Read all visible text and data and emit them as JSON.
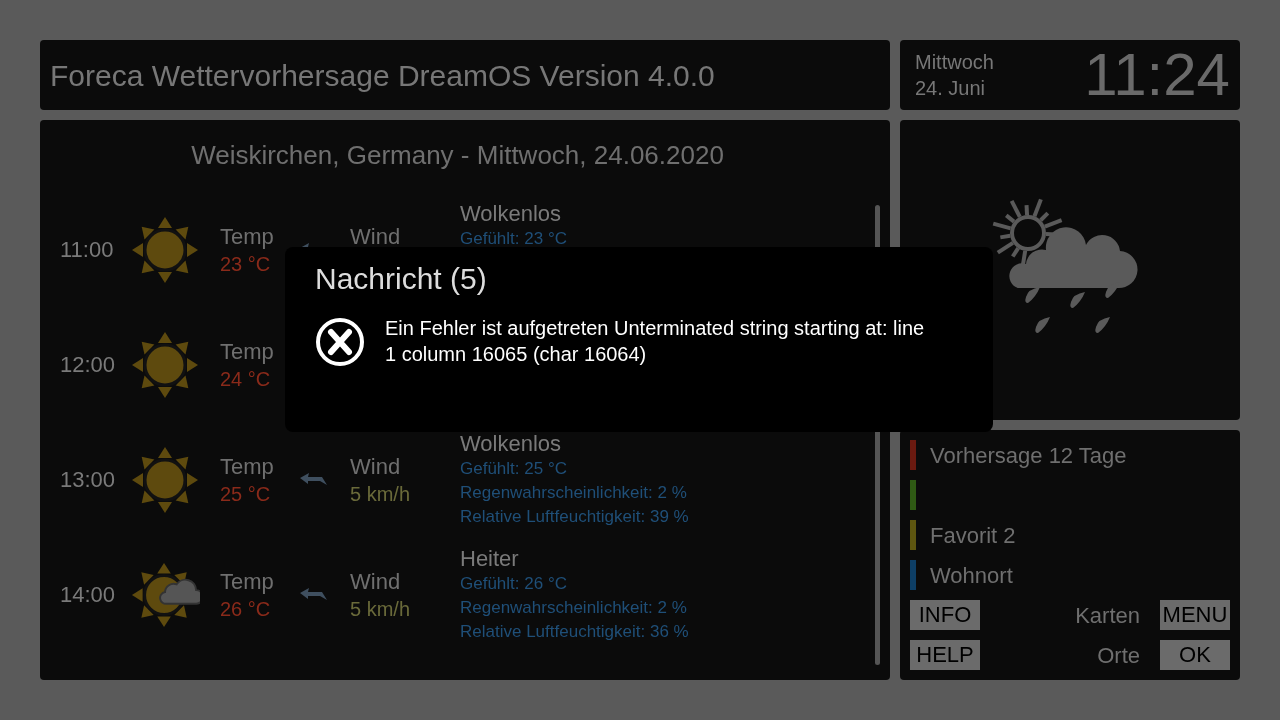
{
  "header": {
    "title": "Foreca Wettervorhersage DreamOS Version 4.0.0"
  },
  "clock": {
    "weekday": "Mittwoch",
    "date": "24. Juni",
    "time": "11:24"
  },
  "forecast": {
    "heading": "Weiskirchen, Germany - Mittwoch, 24.06.2020",
    "rows": [
      {
        "time": "11:00",
        "kind": "sun",
        "temp_label": "Temp",
        "temp": "23 °C",
        "wind_label": "Wind",
        "condition": "Wolkenlos",
        "feels": "Gefühlt: 23 °C"
      },
      {
        "time": "12:00",
        "kind": "sun",
        "temp_label": "Temp",
        "temp": "24 °C"
      },
      {
        "time": "13:00",
        "kind": "sun",
        "temp_label": "Temp",
        "temp": "25 °C",
        "wind_label": "Wind",
        "wind": "5 km/h",
        "condition": "Wolkenlos",
        "feels": "Gefühlt: 25 °C",
        "rain": "Regenwahrscheinlichkeit: 2 %",
        "humidity": "Relative Luftfeuchtigkeit: 39 %"
      },
      {
        "time": "14:00",
        "kind": "sun_cloud",
        "temp_label": "Temp",
        "temp": "26 °C",
        "wind_label": "Wind",
        "wind": "5 km/h",
        "condition": "Heiter",
        "feels": "Gefühlt: 26 °C",
        "rain": "Regenwahrscheinlichkeit: 2 %",
        "humidity": "Relative Luftfeuchtigkeit: 36 %"
      }
    ]
  },
  "current": {
    "kind": "sun_cloud_rain"
  },
  "menu": {
    "items": [
      {
        "label": "Vorhersage 12 Tage",
        "color": "#6a1a10"
      },
      {
        "color": "#2f5a14"
      },
      {
        "label": "Favorit 2",
        "color": "#5e5610"
      },
      {
        "label": "Wohnort",
        "color": "#0e3f66"
      }
    ],
    "button_rows": [
      {
        "left": "INFO",
        "label": "Karten",
        "right": "MENU"
      },
      {
        "left": "HELP",
        "label": "Orte",
        "right": "OK"
      }
    ]
  },
  "dialog": {
    "title": "Nachricht (5)",
    "kind": "error",
    "message": "Ein Fehler ist aufgetreten Unterminated string starting at: line 1 column 16065 (char 16064)"
  }
}
